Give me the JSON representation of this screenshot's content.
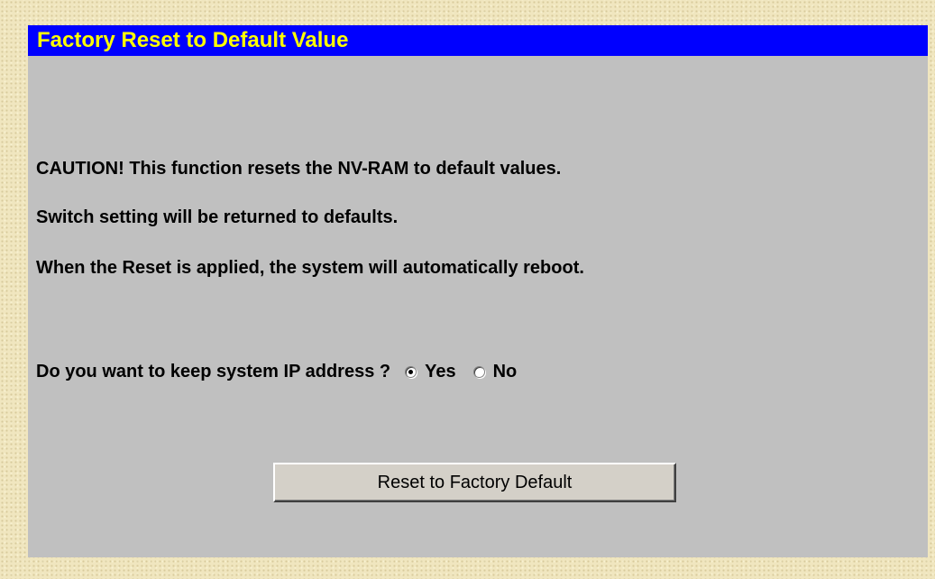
{
  "panel": {
    "title": "Factory Reset to Default Value",
    "caution_lines": [
      "CAUTION! This function resets the NV-RAM to default values.",
      "Switch setting will be returned to defaults.",
      "When the Reset is applied, the system will automatically reboot."
    ],
    "question": "Do you want to keep system IP address ?",
    "options": [
      {
        "label": "Yes",
        "selected": true
      },
      {
        "label": "No",
        "selected": false
      }
    ],
    "reset_button_label": "Reset to Factory Default"
  },
  "colors": {
    "title_bar_background": "#0000ff",
    "title_text": "#ffff00",
    "panel_background": "#c0c0c0",
    "page_background": "#f0e6bf"
  }
}
